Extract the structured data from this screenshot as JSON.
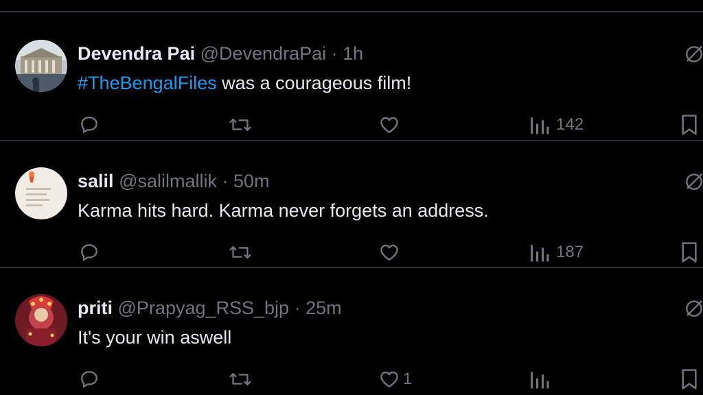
{
  "tweets": [
    {
      "name": "Devendra Pai",
      "handle": "@DevendraPai",
      "separator": "·",
      "time": "1h",
      "text_hashtag": "#TheBengalFiles",
      "text": " was a courageous film!",
      "like_count": "",
      "views": "142"
    },
    {
      "name": "salil",
      "handle": "@salilmallik",
      "separator": "·",
      "time": "50m",
      "text_hashtag": "",
      "text": "Karma hits hard. Karma never forgets an address.",
      "like_count": "",
      "views": "187"
    },
    {
      "name": "priti",
      "handle": "@Prapyag_RSS_bjp",
      "separator": "·",
      "time": "25m",
      "text_hashtag": "",
      "text": "It's your win aswell",
      "like_count": "1",
      "views": ""
    }
  ],
  "icons": [
    "reply-icon",
    "retweet-icon",
    "like-icon",
    "views-icon",
    "bookmark-icon",
    "grok-icon"
  ],
  "colors": {
    "background": "#000000",
    "text": "#e7e9ea",
    "muted": "#71767b",
    "link": "#1d9bf0",
    "divider": "#2f3336"
  }
}
